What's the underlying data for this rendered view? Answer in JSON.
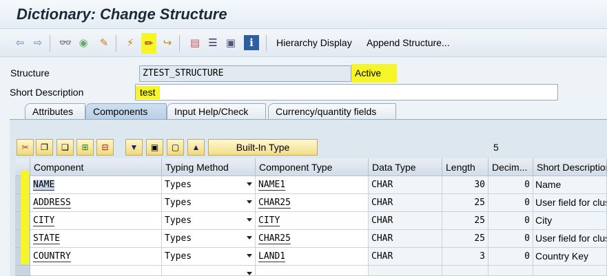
{
  "window": {
    "title": "Dictionary: Change Structure"
  },
  "toolbar": {
    "icons": [
      "back-icon",
      "forward-icon",
      "glasses-icon",
      "other-object-icon",
      "display-change-icon",
      "activate-icon",
      "pencil-icon",
      "transport-icon",
      "hierarchy-icon",
      "list-icon",
      "layout-icon",
      "info-icon"
    ],
    "hierarchy_display": "Hierarchy Display",
    "append_structure": "Append Structure..."
  },
  "header": {
    "structure_label": "Structure",
    "structure_value": "ZTEST_STRUCTURE",
    "status": "Active",
    "short_desc_label": "Short Description",
    "short_desc_value": "test"
  },
  "tabs": [
    {
      "label": "Attributes",
      "active": false
    },
    {
      "label": "Components",
      "active": true
    },
    {
      "label": "Input Help/Check",
      "active": false
    },
    {
      "label": "Currency/quantity fields",
      "active": false
    }
  ],
  "grid_toolbar": {
    "icons": [
      "cut-icon",
      "copy-icon",
      "paste-icon",
      "insert-row-icon",
      "delete-row-icon",
      "sort-icon",
      "select-icon",
      "deselect-icon",
      "top-icon"
    ],
    "builtin_type": "Built-In Type",
    "count": "5"
  },
  "columns": [
    "Component",
    "Typing Method",
    "Component Type",
    "Data Type",
    "Length",
    "Decim...",
    "Short Description"
  ],
  "rows": [
    {
      "component": "NAME",
      "typing": "Types",
      "ctype": "NAME1",
      "dtype": "CHAR",
      "length": "30",
      "decimals": "0",
      "desc": "Name"
    },
    {
      "component": "ADDRESS",
      "typing": "Types",
      "ctype": "CHAR25",
      "dtype": "CHAR",
      "length": "25",
      "decimals": "0",
      "desc": "User field for cluster"
    },
    {
      "component": "CITY",
      "typing": "Types",
      "ctype": "CITY",
      "dtype": "CHAR",
      "length": "25",
      "decimals": "0",
      "desc": "City"
    },
    {
      "component": "STATE",
      "typing": "Types",
      "ctype": "CHAR25",
      "dtype": "CHAR",
      "length": "25",
      "decimals": "0",
      "desc": "User field for cluster"
    },
    {
      "component": "COUNTRY",
      "typing": "Types",
      "ctype": "LAND1",
      "dtype": "CHAR",
      "length": "3",
      "decimals": "0",
      "desc": "Country Key"
    }
  ],
  "colors": {
    "highlight": "#f5f528",
    "tab_active": "#b8cfe6",
    "title": "#1a2a3a"
  }
}
